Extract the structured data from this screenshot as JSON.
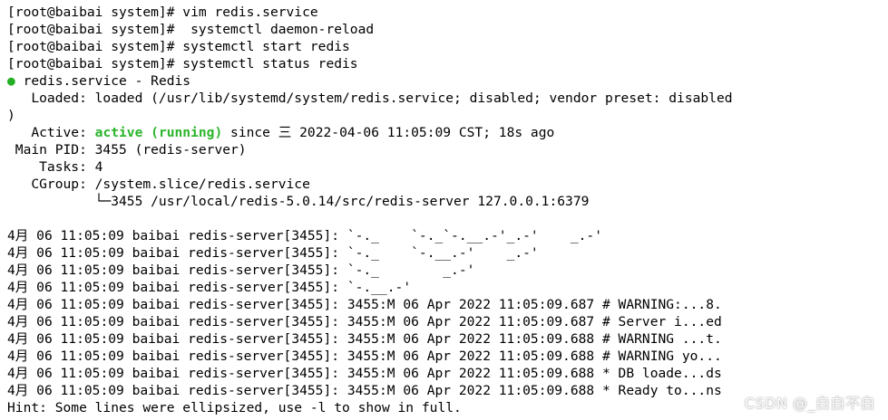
{
  "terminal": {
    "lines": [
      "[root@baibai system]# vim redis.service",
      "[root@baibai system]#  systemctl daemon-reload",
      "[root@baibai system]# systemctl start redis",
      "[root@baibai system]# systemctl status redis",
      "",
      "   Loaded: loaded (/usr/lib/systemd/system/redis.service; disabled; vendor preset: disabled",
      ")",
      "",
      " Main PID: 3455 (redis-server)",
      "    Tasks: 4",
      "   CGroup: /system.slice/redis.service",
      "           └─3455 /usr/local/redis-5.0.14/src/redis-server 127.0.0.1:6379",
      "",
      "4月 06 11:05:09 baibai redis-server[3455]: `-._    `-._`-.__.-'_.-'    _.-'",
      "4月 06 11:05:09 baibai redis-server[3455]: `-._    `-.__.-'    _.-'",
      "4月 06 11:05:09 baibai redis-server[3455]: `-._        _.-'",
      "4月 06 11:05:09 baibai redis-server[3455]: `-.__.-'",
      "4月 06 11:05:09 baibai redis-server[3455]: 3455:M 06 Apr 2022 11:05:09.687 # WARNING:...8.",
      "4月 06 11:05:09 baibai redis-server[3455]: 3455:M 06 Apr 2022 11:05:09.687 # Server i...ed",
      "4月 06 11:05:09 baibai redis-server[3455]: 3455:M 06 Apr 2022 11:05:09.688 # WARNING ...t.",
      "4月 06 11:05:09 baibai redis-server[3455]: 3455:M 06 Apr 2022 11:05:09.688 # WARNING yo...",
      "4月 06 11:05:09 baibai redis-server[3455]: 3455:M 06 Apr 2022 11:05:09.688 * DB loade...ds",
      "4月 06 11:05:09 baibai redis-server[3455]: 3455:M 06 Apr 2022 11:05:09.688 * Ready to...ns",
      "Hint: Some lines were ellipsized, use -l to show in full."
    ],
    "service_line": {
      "dot": "●",
      "text": " redis.service - Redis"
    },
    "active_line": {
      "prefix": "   Active: ",
      "state": "active (running)",
      "suffix": " since 三 2022-04-06 11:05:09 CST; 18s ago"
    }
  },
  "watermark": "CSDN @_白白不白",
  "colors": {
    "background": "#ffffff",
    "text": "#000000",
    "active_green": "#2bb52b"
  }
}
